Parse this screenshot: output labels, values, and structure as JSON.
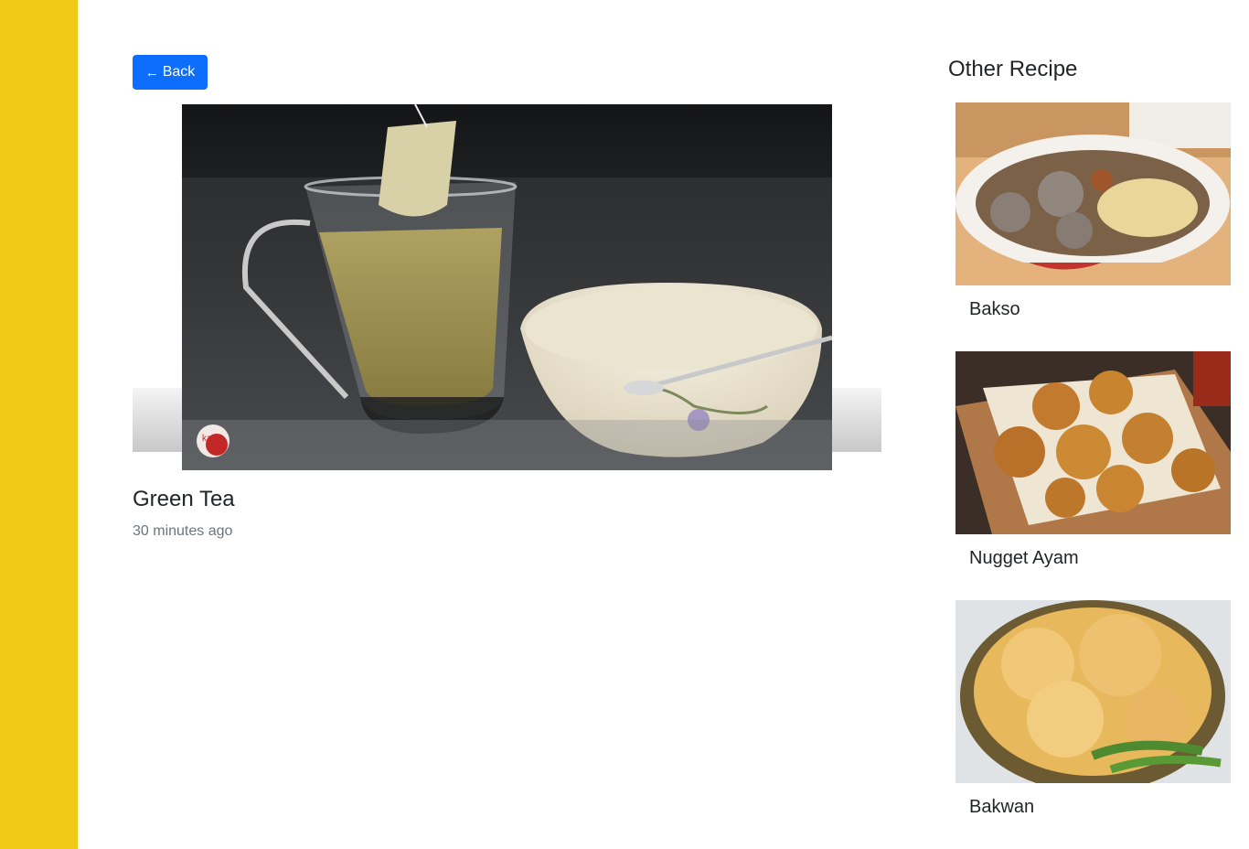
{
  "page": {
    "back_label": "Back"
  },
  "recipe": {
    "title": "Green Tea",
    "time": "30 minutes ago"
  },
  "sidebar": {
    "heading": "Other Recipe",
    "items": [
      {
        "label": "Bakso",
        "image": "bakso-image"
      },
      {
        "label": "Nugget Ayam",
        "image": "nugget-ayam-image"
      },
      {
        "label": "Bakwan",
        "image": "bakwan-image"
      }
    ]
  },
  "colors": {
    "sidebar_accent": "#f1c917",
    "primary_button": "#0d6efd"
  }
}
